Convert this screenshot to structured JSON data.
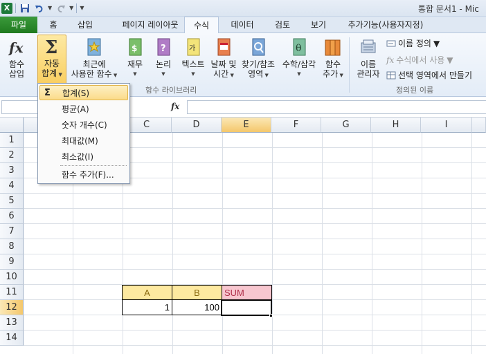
{
  "window": {
    "title": "통합 문서1 - Mic",
    "app_icon": "X"
  },
  "tabs": [
    {
      "label": "파일"
    },
    {
      "label": "홈"
    },
    {
      "label": "삽입"
    },
    {
      "label": "페이지 레이아웃"
    },
    {
      "label": "수식"
    },
    {
      "label": "데이터"
    },
    {
      "label": "검토"
    },
    {
      "label": "보기"
    },
    {
      "label": "추가기능(사용자지정)"
    }
  ],
  "ribbon": {
    "insert_function": {
      "line1": "함수",
      "line2": "삽입"
    },
    "autosum": {
      "line1": "자동",
      "line2": "합계"
    },
    "recent": {
      "line1": "최근에",
      "line2": "사용한 함수"
    },
    "financial": {
      "line1": "재무"
    },
    "logical": {
      "line1": "논리"
    },
    "text": {
      "line1": "텍스트"
    },
    "datetime": {
      "line1": "날짜 및",
      "line2": "시간"
    },
    "lookup": {
      "line1": "찾기/참조",
      "line2": "영역"
    },
    "math": {
      "line1": "수학/삼각"
    },
    "more": {
      "line1": "함수",
      "line2": "추가"
    },
    "group_library": "함수 라이브러리",
    "name_manager": {
      "line1": "이름",
      "line2": "관리자"
    },
    "define_name": "이름 정의",
    "use_in_formula": "수식에서 사용",
    "create_from_selection": "선택 영역에서 만들기",
    "group_names": "정의된 이름"
  },
  "formula_bar": {
    "fx": "fx",
    "value": ""
  },
  "columns": [
    "C",
    "D",
    "E",
    "F",
    "G",
    "H",
    "I"
  ],
  "rows": [
    "1",
    "2",
    "3",
    "4",
    "5",
    "6",
    "7",
    "8",
    "9",
    "10",
    "11",
    "12",
    "13",
    "14"
  ],
  "cells": {
    "C11": "A",
    "D11": "B",
    "E11": "SUM",
    "C12": "1",
    "D12": "100",
    "E12": ""
  },
  "autosum_menu": {
    "items": [
      "합계(S)",
      "평균(A)",
      "숫자 개수(C)",
      "최대값(M)",
      "최소값(I)",
      "함수 추가(F)..."
    ]
  },
  "colors": {
    "file_tab": "#1f7a1f",
    "header_fill": "#fde9a0",
    "sum_fill": "#f7c6cf",
    "selection": "#f4c76b"
  }
}
